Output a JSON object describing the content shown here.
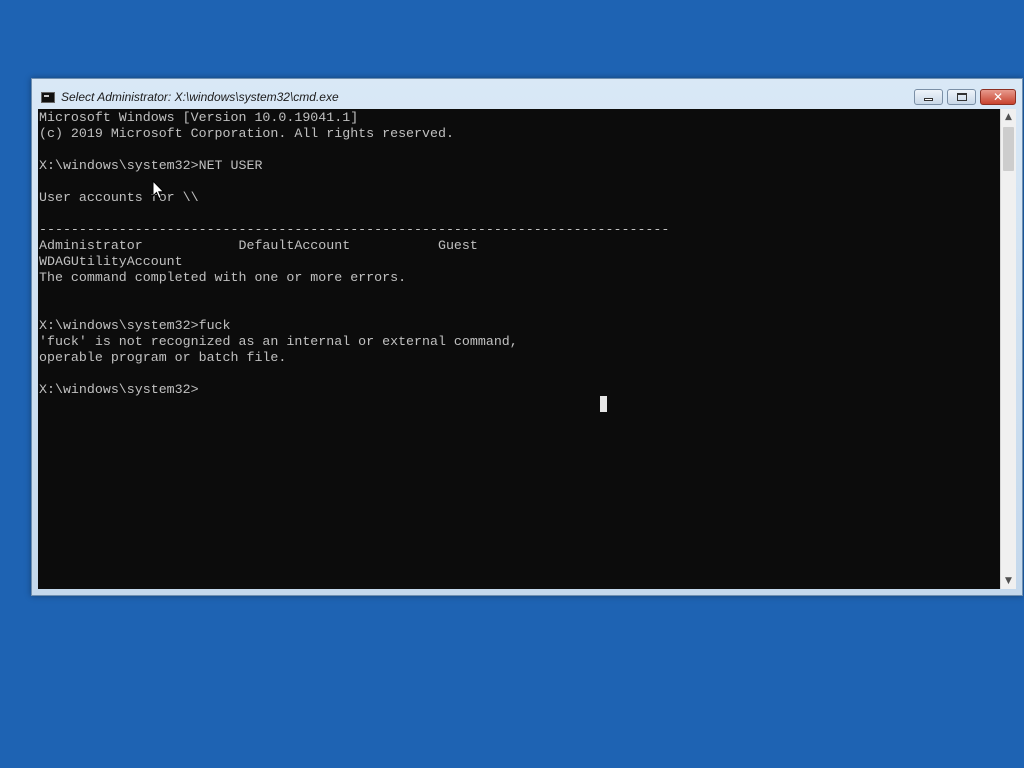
{
  "window": {
    "title": "Select Administrator: X:\\windows\\system32\\cmd.exe",
    "icon": "cmd-console-icon",
    "controls": {
      "minimize_icon": "minimize-icon",
      "maximize_icon": "maximize-icon",
      "close_icon": "close-icon",
      "close_glyph": "✕"
    }
  },
  "console": {
    "background": "#0c0c0c",
    "foreground": "#c0c0c0",
    "lines": [
      "Microsoft Windows [Version 10.0.19041.1]",
      "(c) 2019 Microsoft Corporation. All rights reserved.",
      "",
      "X:\\windows\\system32>NET USER",
      "",
      "User accounts for \\\\",
      "",
      "-------------------------------------------------------------------------------",
      "Administrator            DefaultAccount           Guest",
      "WDAGUtilityAccount",
      "The command completed with one or more errors.",
      "",
      "",
      "X:\\windows\\system32>fuck",
      "'fuck' is not recognized as an internal or external command,",
      "operable program or batch file.",
      "",
      "X:\\windows\\system32>"
    ]
  },
  "scrollbar": {
    "up_arrow": "▲",
    "down_arrow": "▼"
  },
  "desktop": {
    "background": "#1e63b3"
  }
}
